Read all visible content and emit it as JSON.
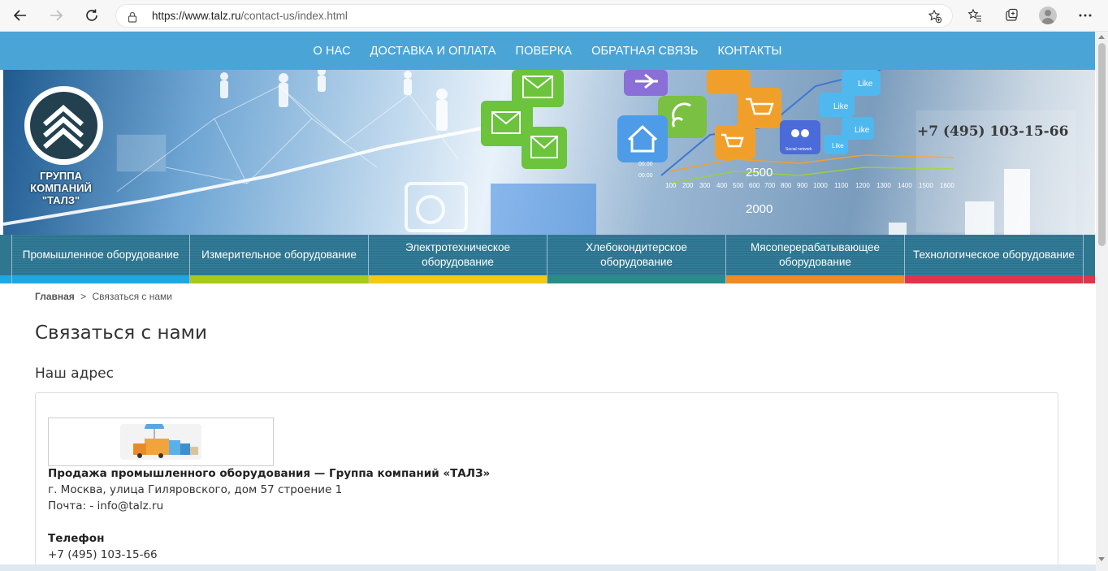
{
  "browser": {
    "url_host": "https://www.talz.ru",
    "url_path": "/contact-us/index.html",
    "icons": [
      "back-arrow-icon",
      "forward-arrow-icon",
      "reload-icon",
      "lock-icon",
      "add-favorite-icon",
      "favorites-icon",
      "collections-icon",
      "profile-icon",
      "more-icon"
    ]
  },
  "topnav": {
    "items": [
      "О НАС",
      "ДОСТАВКА И ОПЛАТА",
      "ПОВЕРКА",
      "ОБРАТНАЯ СВЯЗЬ",
      "КОНТАКТЫ"
    ]
  },
  "banner": {
    "logo_line1": "ГРУППА",
    "logo_line2": "КОМПАНИЙ",
    "logo_line3": "\"ТАЛЗ\"",
    "phone": "+7 (495) 103-15-66",
    "labels": [
      "Like",
      "Like",
      "Like",
      "Like",
      "Social network",
      "2500",
      "2000",
      "00:00",
      "00:00"
    ],
    "axis": [
      "100",
      "200",
      "300",
      "400",
      "500",
      "600",
      "700",
      "800",
      "900",
      "1000",
      "1100",
      "1200",
      "1300",
      "1400",
      "1500",
      "1600"
    ]
  },
  "categories": [
    {
      "label": "Промышленное оборудование",
      "color": "#1fa7e3"
    },
    {
      "label": "Измерительное оборудование",
      "color": "#a8c81a"
    },
    {
      "label": "Электротехническое оборудование",
      "color": "#f6c90e"
    },
    {
      "label": "Хлебокондитерское оборудование",
      "color": "#2a8c8a"
    },
    {
      "label": "Мясоперерабатывающее оборудование",
      "color": "#f08a24"
    },
    {
      "label": "Технологическое оборудование",
      "color": "#e2334b"
    }
  ],
  "breadcrumb": {
    "home": "Главная",
    "separator": ">",
    "current": "Связаться с нами"
  },
  "page": {
    "title": "Связаться с нами",
    "section_title": "Наш адрес",
    "company": "Продажа промышленного оборудования — Группа компаний «ТАЛЗ»",
    "address": "г. Москва, улица Гиляровского, дом 57 строение 1",
    "mail": "Почта: - info@talz.ru",
    "phone_label": "Телефон",
    "phone": "+7 (495) 103-15-66"
  }
}
